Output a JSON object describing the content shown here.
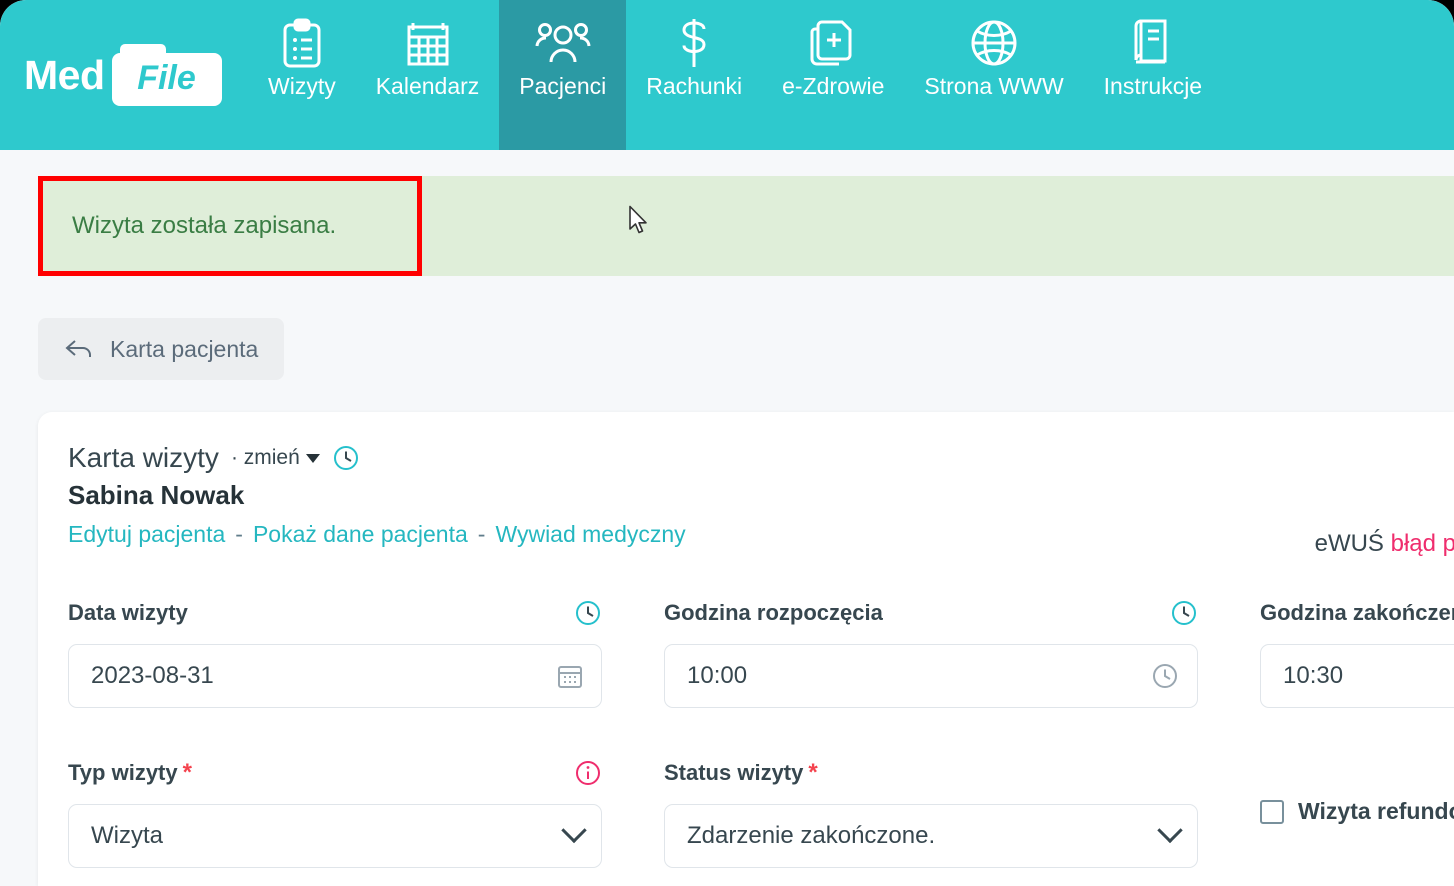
{
  "app": {
    "brand_first": "Med",
    "brand_second": "File"
  },
  "nav": {
    "items": [
      {
        "label": "Wizyty",
        "icon": "clipboard-icon",
        "active": false
      },
      {
        "label": "Kalendarz",
        "icon": "calendar-icon",
        "active": false
      },
      {
        "label": "Pacjenci",
        "icon": "patients-icon",
        "active": true
      },
      {
        "label": "Rachunki",
        "icon": "dollar-icon",
        "active": false
      },
      {
        "label": "e-Zdrowie",
        "icon": "medical-file-icon",
        "active": false
      },
      {
        "label": "Strona WWW",
        "icon": "globe-icon",
        "active": false
      },
      {
        "label": "Instrukcje",
        "icon": "book-icon",
        "active": false
      }
    ]
  },
  "alert": {
    "message": "Wizyta została zapisana.",
    "background_color": "#dfeed9",
    "text_color": "#3a7d44",
    "highlight_color": "#ff0000"
  },
  "back_button": {
    "label": "Karta pacjenta",
    "icon": "back-arrow-icon"
  },
  "card": {
    "title": "Karta wizyty",
    "change_label": "· zmień",
    "patient_name": "Sabina Nowak",
    "links": [
      {
        "label": "Edytuj pacjenta"
      },
      {
        "label": "Pokaż dane pacjenta"
      },
      {
        "label": "Wywiad medyczny"
      }
    ],
    "link_separator": "-",
    "ewus_label": "eWUŚ",
    "ewus_status": "błąd p"
  },
  "form": {
    "fields": [
      {
        "label": "Data wizyty",
        "required": false,
        "label_icon": "clock-icon",
        "value": "2023-08-31",
        "adorn_icon": "calendar-icon",
        "type": "date"
      },
      {
        "label": "Godzina rozpoczęcia",
        "required": false,
        "label_icon": "clock-icon",
        "value": "10:00",
        "adorn_icon": "clock-icon",
        "type": "time"
      },
      {
        "label": "Godzina zakończenia",
        "required": false,
        "label_icon": "none",
        "value": "10:30",
        "adorn_icon": "none",
        "type": "time"
      },
      {
        "label": "Typ wizyty",
        "required": true,
        "label_icon": "info-icon",
        "value": "Wizyta",
        "adorn_icon": "chevron-down-icon",
        "type": "select"
      },
      {
        "label": "Status wizyty",
        "required": true,
        "label_icon": "none",
        "value": "Zdarzenie zakończone.",
        "adorn_icon": "chevron-down-icon",
        "type": "select"
      }
    ],
    "checkbox": {
      "label": "Wizyta refundowana",
      "checked": false
    },
    "required_marker": "*"
  },
  "colors": {
    "brand_teal": "#2ec9cd",
    "active_tab": "#2b9aa4",
    "link_teal": "#25b7c0",
    "required_red": "#f4434e",
    "error_pink": "#ef2d6d",
    "page_bg": "#f6f8fa"
  }
}
